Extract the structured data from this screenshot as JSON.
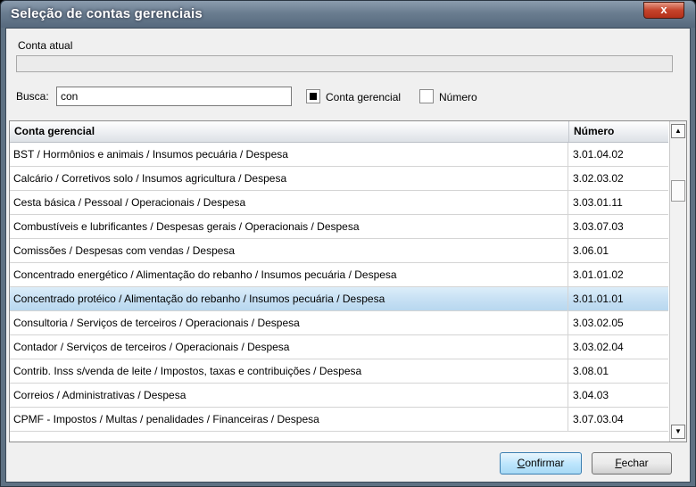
{
  "window": {
    "title": "Seleção de contas gerenciais",
    "close_glyph": "x"
  },
  "conta_atual": {
    "label": "Conta atual",
    "value": ""
  },
  "busca": {
    "label": "Busca:",
    "value": "con"
  },
  "filters": {
    "conta_gerencial": {
      "label": "Conta gerencial",
      "checked": true
    },
    "numero": {
      "label": "Número",
      "checked": false
    }
  },
  "table": {
    "columns": [
      "Conta gerencial",
      "Número"
    ],
    "rows": [
      {
        "conta": "BST / Hormônios e animais / Insumos pecuária / Despesa",
        "numero": "3.01.04.02"
      },
      {
        "conta": "Calcário / Corretivos solo / Insumos agricultura / Despesa",
        "numero": "3.02.03.02"
      },
      {
        "conta": "Cesta básica / Pessoal / Operacionais / Despesa",
        "numero": "3.03.01.11"
      },
      {
        "conta": "Combustíveis e lubrificantes / Despesas gerais / Operacionais / Despesa",
        "numero": "3.03.07.03"
      },
      {
        "conta": "Comissões / Despesas com vendas / Despesa",
        "numero": "3.06.01"
      },
      {
        "conta": "Concentrado energético / Alimentação do rebanho / Insumos pecuária / Despesa",
        "numero": "3.01.01.02"
      },
      {
        "conta": "Concentrado protéico / Alimentação do rebanho / Insumos pecuária / Despesa",
        "numero": "3.01.01.01",
        "selected": true
      },
      {
        "conta": "Consultoria / Serviços de terceiros / Operacionais / Despesa",
        "numero": "3.03.02.05"
      },
      {
        "conta": "Contador / Serviços de terceiros / Operacionais / Despesa",
        "numero": "3.03.02.04"
      },
      {
        "conta": "Contrib. Inss s/venda de leite / Impostos, taxas e contribuições / Despesa",
        "numero": "3.08.01"
      },
      {
        "conta": "Correios / Administrativas / Despesa",
        "numero": "3.04.03"
      },
      {
        "conta": "CPMF - Impostos / Multas / penalidades / Financeiras / Despesa",
        "numero": "3.07.03.04"
      }
    ]
  },
  "buttons": {
    "confirm": {
      "mnemonic": "C",
      "rest": "onfirmar"
    },
    "close": {
      "mnemonic": "F",
      "rest": "echar"
    }
  },
  "icons": {
    "scroll_up": "▲",
    "scroll_down": "▼"
  }
}
